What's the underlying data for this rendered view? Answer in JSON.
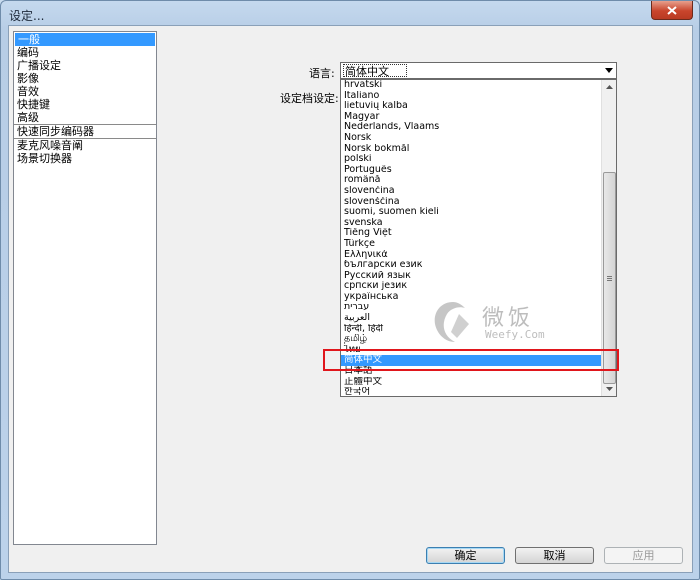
{
  "window": {
    "title": "设定..."
  },
  "sidebar": {
    "items": [
      {
        "label": "一般",
        "selected": true
      },
      {
        "label": "编码"
      },
      {
        "label": "广播设定"
      },
      {
        "label": "影像"
      },
      {
        "label": "音效"
      },
      {
        "label": "快捷键"
      },
      {
        "label": "高级"
      },
      {
        "label": "快速同步编码器",
        "separator_before": true
      },
      {
        "label": "麦克风噪音阐",
        "separator_before": true
      },
      {
        "label": "场景切换器"
      }
    ]
  },
  "form": {
    "language_label": "语言:",
    "profile_label": "设定档设定:",
    "language_value": "简体中文"
  },
  "language_list": {
    "items": [
      "hrvatski",
      "Italiano",
      "lietuvių kalba",
      "Magyar",
      "Nederlands, Vlaams",
      "Norsk",
      "Norsk bokmål",
      "polski",
      "Português",
      "română",
      "slovenčina",
      "slovenščina",
      "suomi, suomen kieli",
      "svenska",
      "Tiếng Việt",
      "Türkçe",
      "Ελληνικά",
      "български език",
      "Русский язык",
      "српски језик",
      "українська",
      "עברית",
      "العربية",
      "हिन्दी, हिंदी",
      "தமிழ்",
      "ไทย",
      "简体中文",
      "日本語",
      "正體中文",
      "한국어"
    ],
    "selected_index": 26
  },
  "watermark": {
    "cn": "微饭",
    "en": "Weefy.Com"
  },
  "buttons": {
    "ok": "确定",
    "cancel": "取消",
    "apply": "应用"
  }
}
